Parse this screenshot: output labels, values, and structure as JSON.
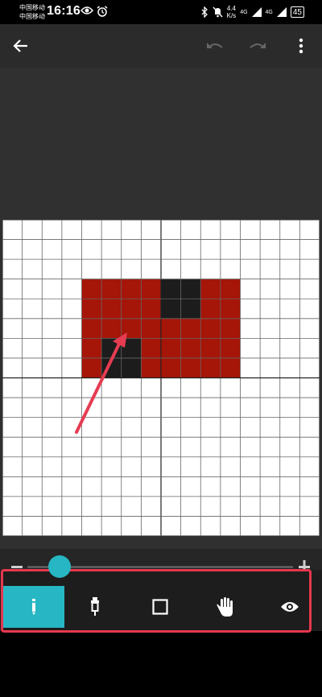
{
  "status": {
    "carrier1": "中国移动",
    "carrier2": "中国移动",
    "time": "16:16",
    "speed_value": "4.4",
    "speed_unit": "K/s",
    "net1": "4G",
    "net2": "4G",
    "battery": "45"
  },
  "app_bar": {
    "back_icon": "arrow-left-icon",
    "undo_icon": "undo-icon",
    "redo_icon": "redo-icon",
    "menu_icon": "more-vert-icon"
  },
  "canvas": {
    "columns": 16,
    "rows": 16,
    "background": "#ffffff",
    "grid_color": "#666666",
    "section_line_color": "#222222",
    "palette": {
      "R": "#a51508",
      "K": "#1c1c1c"
    },
    "pixels": [
      "................",
      "................",
      "................",
      "....RRRRKKRR....",
      "....RRRRKKRR....",
      "....RRRRRRRR....",
      "....RKKRRRRR....",
      "....RKKRRRRR....",
      "................",
      "................",
      "................",
      "................",
      "................",
      "................",
      "................",
      "................"
    ]
  },
  "annotation_arrow_color": "#e63c52",
  "zoom": {
    "minus_icon": "minus-icon",
    "plus_icon": "plus-icon",
    "level": 0.12,
    "accent": "#27b7c4"
  },
  "tools": [
    {
      "name": "pencil",
      "icon": "pencil-icon",
      "active": true
    },
    {
      "name": "eyedropper",
      "icon": "eyedropper-icon",
      "active": false
    },
    {
      "name": "eraser",
      "icon": "square-icon",
      "active": false
    },
    {
      "name": "pan",
      "icon": "hand-icon",
      "active": false
    },
    {
      "name": "preview",
      "icon": "eye-icon",
      "active": false
    }
  ],
  "highlight_color": "#e6384e"
}
